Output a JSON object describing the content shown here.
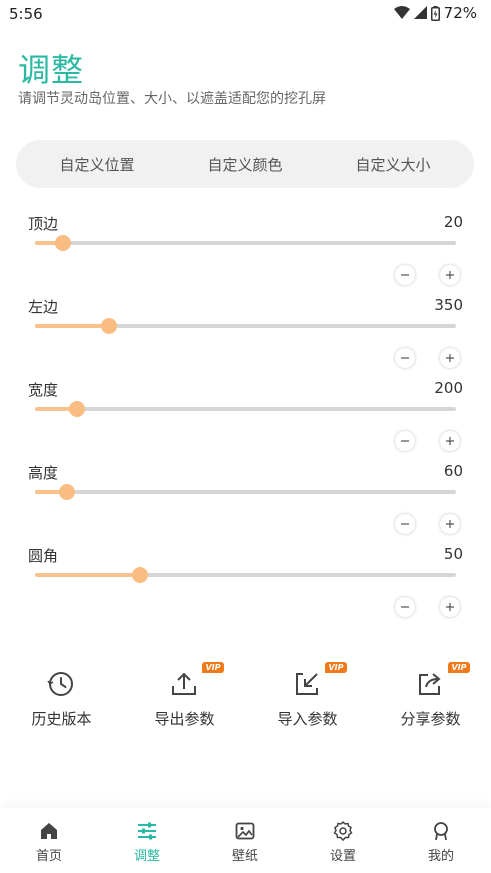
{
  "status_bar": {
    "time": "5:56",
    "battery": "72%"
  },
  "header": {
    "title": "调整",
    "subtitle": "请调节灵动岛位置、大小、以遮盖适配您的挖孔屏"
  },
  "tabs": [
    {
      "label": "自定义位置",
      "active": true
    },
    {
      "label": "自定义颜色",
      "active": false
    },
    {
      "label": "自定义大小",
      "active": false
    }
  ],
  "sliders": [
    {
      "label": "顶边",
      "value": "20",
      "level": 0.066
    },
    {
      "label": "左边",
      "value": "350",
      "level": 0.176
    },
    {
      "label": "宽度",
      "value": "200",
      "level": 0.1
    },
    {
      "label": "高度",
      "value": "60",
      "level": 0.075
    },
    {
      "label": "圆角",
      "value": "50",
      "level": 0.25
    }
  ],
  "actions": [
    {
      "label": "历史版本",
      "icon": "clock-icon",
      "vip": false
    },
    {
      "label": "导出参数",
      "icon": "upload-icon",
      "vip": true,
      "badge": "VIP"
    },
    {
      "label": "导入参数",
      "icon": "import-icon",
      "vip": true,
      "badge": "VIP"
    },
    {
      "label": "分享参数",
      "icon": "share-icon",
      "vip": true,
      "badge": "VIP"
    }
  ],
  "bottom_nav": [
    {
      "label": "首页",
      "icon": "home-icon",
      "active": false
    },
    {
      "label": "调整",
      "icon": "sliders-icon",
      "active": true
    },
    {
      "label": "壁纸",
      "icon": "image-icon",
      "active": false
    },
    {
      "label": "设置",
      "icon": "gear-icon",
      "active": false
    },
    {
      "label": "我的",
      "icon": "user-icon",
      "active": false
    }
  ],
  "colors": {
    "accent": "#2bb9a3",
    "slider_thumb": "#f9bd82",
    "slider_track": "#d6d6d6",
    "vip_badge": "#f07a1a"
  }
}
